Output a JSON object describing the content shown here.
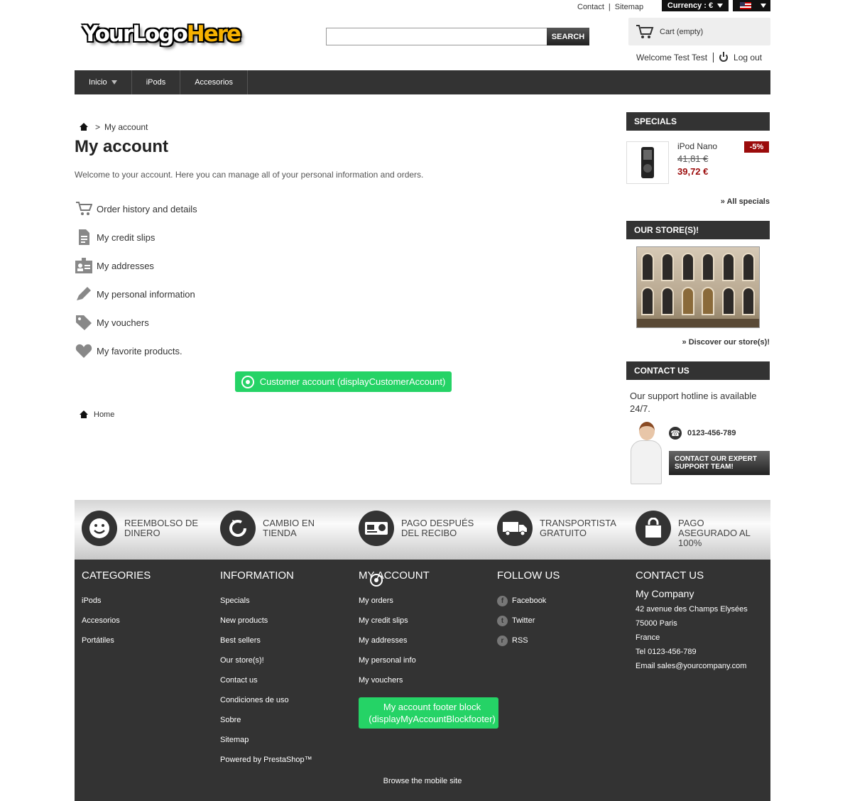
{
  "header": {
    "top_links": [
      "Contact",
      "Sitemap"
    ],
    "currency_label": "Currency : €",
    "logo_your": "YourLogo",
    "logo_here": "Here",
    "search_placeholder": "",
    "search_button": "SEARCH",
    "cart_label": "Cart (empty)",
    "welcome": "Welcome Test Test",
    "logout": "Log out"
  },
  "nav": {
    "items": [
      "Inicio",
      "iPods",
      "Accesorios"
    ]
  },
  "breadcrumb": {
    "separator": ">",
    "current": "My account"
  },
  "main": {
    "title": "My account",
    "intro": "Welcome to your account. Here you can manage all of your personal information and orders.",
    "links": [
      {
        "label": "Order history and details",
        "icon": "cart-icon"
      },
      {
        "label": "My credit slips",
        "icon": "document-icon"
      },
      {
        "label": "My addresses",
        "icon": "id-card-icon"
      },
      {
        "label": "My personal information",
        "icon": "pencil-icon"
      },
      {
        "label": "My vouchers",
        "icon": "tag-icon"
      },
      {
        "label": "My favorite products.",
        "icon": "heart-icon"
      }
    ],
    "hook_button": "Customer account (displayCustomerAccount)",
    "home_link": "Home"
  },
  "sidebar": {
    "specials_title": "SPECIALS",
    "product_name": "iPod Nano",
    "old_price": "41,81 €",
    "new_price": "39,72 €",
    "discount": "-5%",
    "all_specials": "» All specials",
    "stores_title": "OUR STORE(S)!",
    "discover": "» Discover our store(s)!",
    "contact_title": "CONTACT US",
    "hotline": "Our support hotline is available 24/7.",
    "phone": "0123-456-789",
    "expert_button": "CONTACT OUR EXPERT SUPPORT TEAM!"
  },
  "reassurance": [
    {
      "text": "REEMBOLSO DE DINERO",
      "icon": "smiley-icon"
    },
    {
      "text": "CAMBIO EN TIENDA",
      "icon": "refresh-icon"
    },
    {
      "text": "PAGO DESPUÉS DEL RECIBO",
      "icon": "credit-card-icon"
    },
    {
      "text": "TRANSPORTISTA GRATUITO",
      "icon": "truck-icon"
    },
    {
      "text": "PAGO ASEGURADO AL 100%",
      "icon": "bag-icon"
    }
  ],
  "footer": {
    "categories_title": "CATEGORIES",
    "categories": [
      "iPods",
      "Accesorios",
      "Portátiles"
    ],
    "information_title": "INFORMATION",
    "information": [
      "Specials",
      "New products",
      "Best sellers",
      "Our store(s)!",
      "Contact us",
      "Condiciones de uso",
      "Sobre",
      "Sitemap",
      "Powered by PrestaShop™"
    ],
    "account_title": "MY ACCOUNT",
    "account": [
      "My orders",
      "My credit slips",
      "My addresses",
      "My personal info",
      "My vouchers"
    ],
    "account_hook_button": "My account footer block (displayMyAccountBlockfooter)",
    "follow_title": "FOLLOW US",
    "follow": [
      {
        "label": "Facebook",
        "glyph": "f"
      },
      {
        "label": "Twitter",
        "glyph": "t"
      },
      {
        "label": "RSS",
        "glyph": "r"
      }
    ],
    "contact_title": "CONTACT US",
    "company": "My Company",
    "address": [
      "42 avenue des Champs Elysées",
      "75000 Paris",
      "France",
      "Tel 0123-456-789",
      "Email sales@yourcompany.com"
    ],
    "mobile_link": "Browse the mobile site"
  }
}
